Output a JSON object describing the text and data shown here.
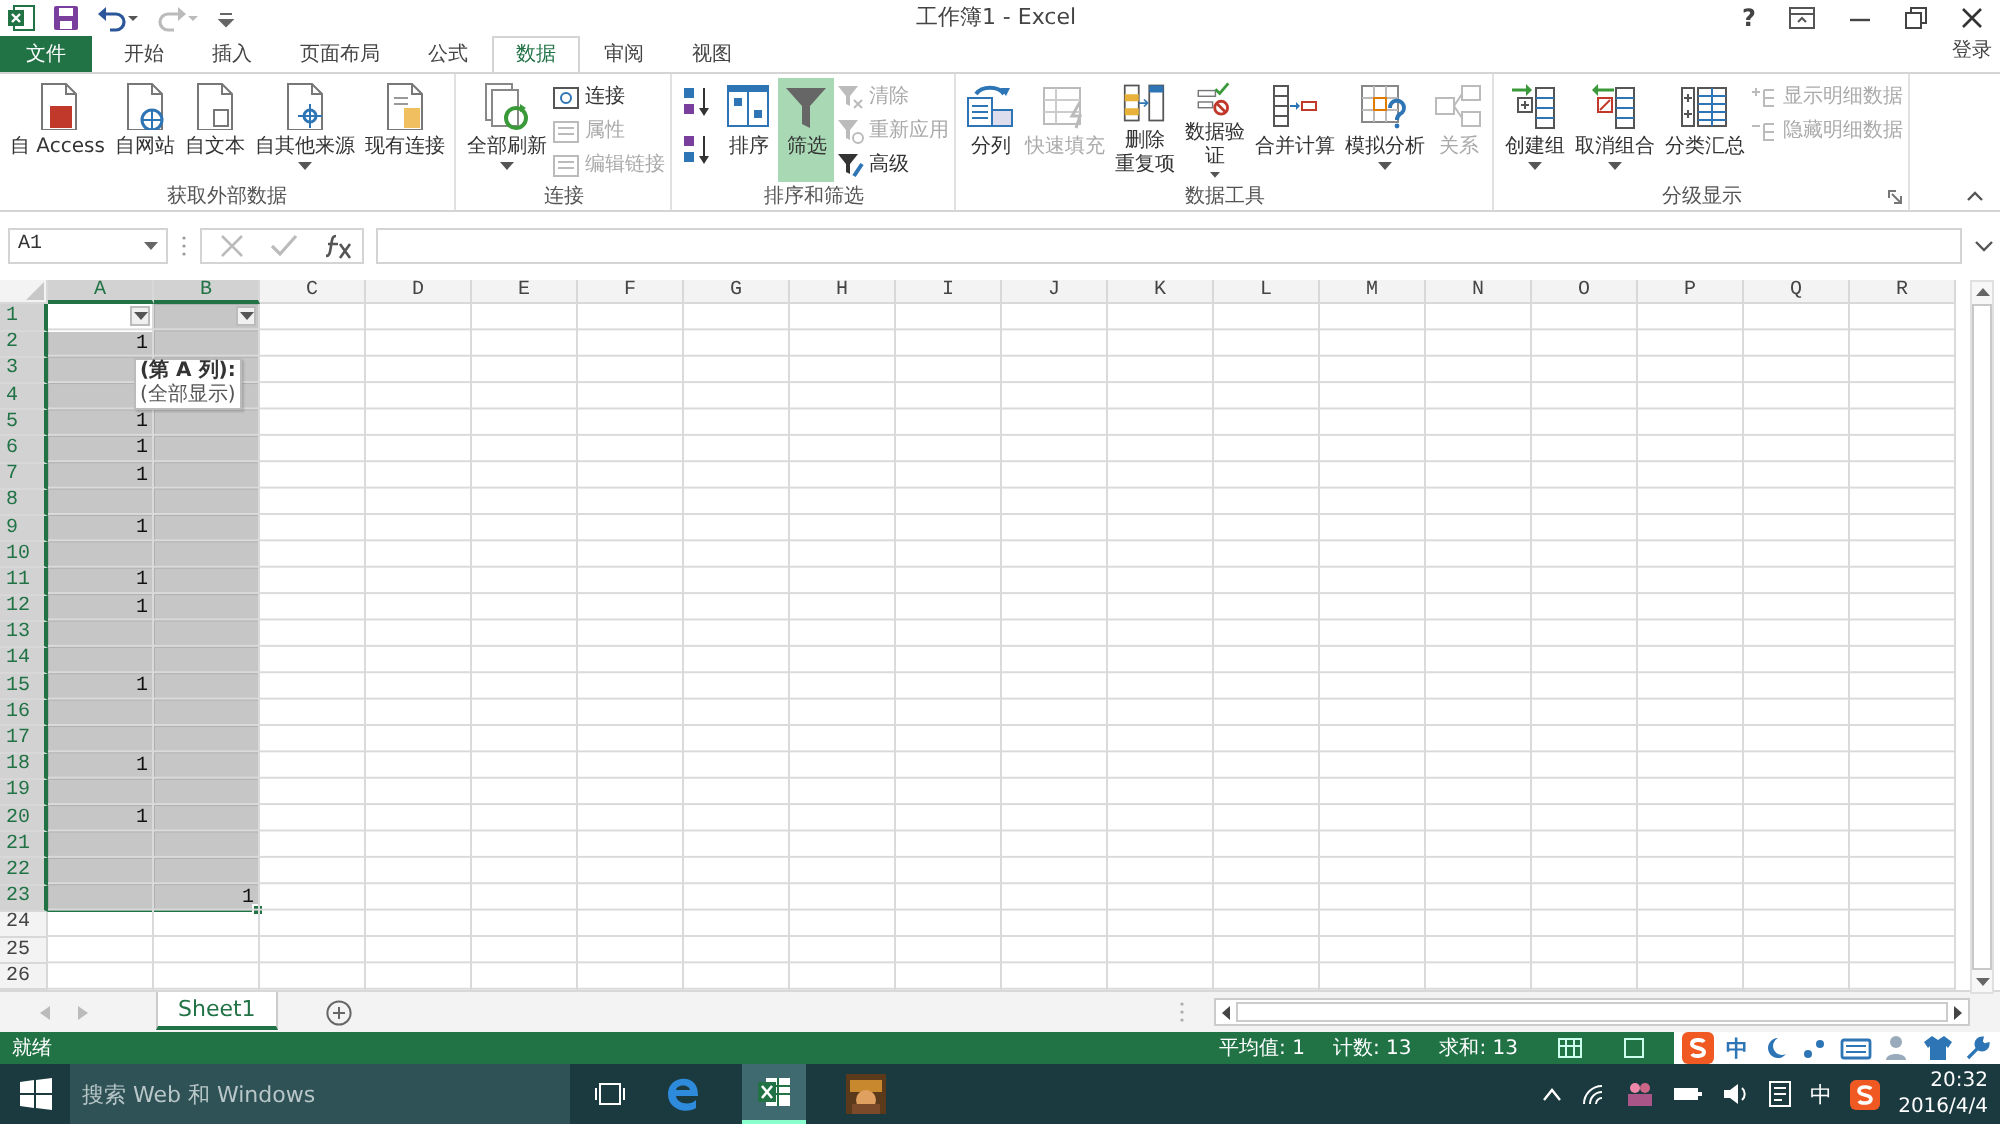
{
  "window": {
    "title": "工作簿1 - Excel",
    "help": "?",
    "account": "登录"
  },
  "tabs": [
    {
      "label": "文件",
      "kind": "file",
      "selected": false
    },
    {
      "label": "开始",
      "kind": "tab",
      "selected": false
    },
    {
      "label": "插入",
      "kind": "tab",
      "selected": false
    },
    {
      "label": "页面布局",
      "kind": "tab",
      "selected": false
    },
    {
      "label": "公式",
      "kind": "tab",
      "selected": false
    },
    {
      "label": "数据",
      "kind": "tab",
      "selected": true
    },
    {
      "label": "审阅",
      "kind": "tab",
      "selected": false
    },
    {
      "label": "视图",
      "kind": "tab",
      "selected": false
    }
  ],
  "ribbon": [
    {
      "label": "获取外部数据",
      "items": [
        {
          "kind": "large",
          "label": "自 Access",
          "disabled": false
        },
        {
          "kind": "large",
          "label": "自网站",
          "disabled": false
        },
        {
          "kind": "large",
          "label": "自文本",
          "disabled": false
        },
        {
          "kind": "large",
          "label": "自其他来源",
          "disabled": false,
          "dropdown": true
        },
        {
          "kind": "large",
          "label": "现有连接",
          "disabled": false
        }
      ]
    },
    {
      "label": "连接",
      "items": [
        {
          "kind": "large",
          "label": "全部刷新",
          "disabled": false,
          "dropdown": true
        },
        {
          "kind": "small",
          "label": "连接",
          "disabled": false
        },
        {
          "kind": "small",
          "label": "属性",
          "disabled": true
        },
        {
          "kind": "small",
          "label": "编辑链接",
          "disabled": true
        }
      ]
    },
    {
      "label": "排序和筛选",
      "items": [
        {
          "kind": "sort",
          "disabled": false
        },
        {
          "kind": "sort",
          "disabled": false
        },
        {
          "kind": "large",
          "label": "排序",
          "disabled": false
        },
        {
          "kind": "large",
          "label": "筛选",
          "disabled": false,
          "pressed": true
        },
        {
          "kind": "small",
          "label": "清除",
          "disabled": true
        },
        {
          "kind": "small",
          "label": "重新应用",
          "disabled": true
        },
        {
          "kind": "small",
          "label": "高级",
          "disabled": false
        }
      ]
    },
    {
      "label": "数据工具",
      "items": [
        {
          "kind": "large",
          "label": "分列",
          "disabled": false
        },
        {
          "kind": "large",
          "label": "快速填充",
          "disabled": true
        },
        {
          "kind": "large",
          "lines": [
            "删除",
            "重复项"
          ],
          "disabled": false
        },
        {
          "kind": "large",
          "lines": [
            "数据验",
            "证"
          ],
          "disabled": false,
          "dropdown": true
        },
        {
          "kind": "large",
          "label": "合并计算",
          "disabled": false
        },
        {
          "kind": "large",
          "label": "模拟分析",
          "disabled": false,
          "dropdown": true
        },
        {
          "kind": "large",
          "label": "关系",
          "disabled": true
        }
      ]
    },
    {
      "label": "分级显示",
      "launcher": true,
      "items": [
        {
          "kind": "large",
          "label": "创建组",
          "disabled": false,
          "dropdown": true
        },
        {
          "kind": "large",
          "label": "取消组合",
          "disabled": false,
          "dropdown": true
        },
        {
          "kind": "large",
          "label": "分类汇总",
          "disabled": false
        },
        {
          "kind": "small",
          "label": "显示明细数据",
          "disabled": true
        },
        {
          "kind": "small",
          "label": "隐藏明细数据",
          "disabled": true
        }
      ]
    }
  ],
  "name_box": "A1",
  "columns": [
    {
      "label": "A",
      "selected": true
    },
    {
      "label": "B",
      "selected": true
    },
    {
      "label": "C",
      "selected": false
    },
    {
      "label": "D",
      "selected": false
    },
    {
      "label": "E",
      "selected": false
    },
    {
      "label": "F",
      "selected": false
    },
    {
      "label": "G",
      "selected": false
    },
    {
      "label": "H",
      "selected": false
    },
    {
      "label": "I",
      "selected": false
    },
    {
      "label": "J",
      "selected": false
    },
    {
      "label": "K",
      "selected": false
    },
    {
      "label": "L",
      "selected": false
    },
    {
      "label": "M",
      "selected": false
    },
    {
      "label": "N",
      "selected": false
    },
    {
      "label": "O",
      "selected": false
    },
    {
      "label": "P",
      "selected": false
    },
    {
      "label": "Q",
      "selected": false
    },
    {
      "label": "R",
      "selected": false
    }
  ],
  "rows": [
    {
      "number": "1",
      "selected": true,
      "filter": true,
      "active": true
    },
    {
      "number": "2",
      "selected": true,
      "a": "1"
    },
    {
      "number": "3",
      "selected": true
    },
    {
      "number": "4",
      "selected": true
    },
    {
      "number": "5",
      "selected": true,
      "a": "1"
    },
    {
      "number": "6",
      "selected": true,
      "a": "1"
    },
    {
      "number": "7",
      "selected": true,
      "a": "1"
    },
    {
      "number": "8",
      "selected": true
    },
    {
      "number": "9",
      "selected": true,
      "a": "1"
    },
    {
      "number": "10",
      "selected": true
    },
    {
      "number": "11",
      "selected": true,
      "a": "1"
    },
    {
      "number": "12",
      "selected": true,
      "a": "1"
    },
    {
      "number": "13",
      "selected": true
    },
    {
      "number": "14",
      "selected": true
    },
    {
      "number": "15",
      "selected": true,
      "a": "1"
    },
    {
      "number": "16",
      "selected": true
    },
    {
      "number": "17",
      "selected": true
    },
    {
      "number": "18",
      "selected": true,
      "a": "1"
    },
    {
      "number": "19",
      "selected": true
    },
    {
      "number": "20",
      "selected": true,
      "a": "1"
    },
    {
      "number": "21",
      "selected": true
    },
    {
      "number": "22",
      "selected": true
    },
    {
      "number": "23",
      "selected": true,
      "b": "1"
    },
    {
      "number": "24",
      "selected": false
    },
    {
      "number": "25",
      "selected": false
    },
    {
      "number": "26",
      "selected": false
    }
  ],
  "tooltip": {
    "title": "(第 A 列):",
    "text": "(全部显示)"
  },
  "sheet_tabs": [
    {
      "label": "Sheet1",
      "selected": true
    }
  ],
  "status_bar": {
    "text": "就绪",
    "stats": [
      "平均值: 1",
      "计数: 13",
      "求和: 13"
    ]
  },
  "ime_bar": {
    "mode": "中"
  },
  "taskbar": {
    "search_placeholder": "搜索 Web 和 Windows",
    "input_mode": "中",
    "time": "20:32",
    "date": "2016/4/4"
  }
}
